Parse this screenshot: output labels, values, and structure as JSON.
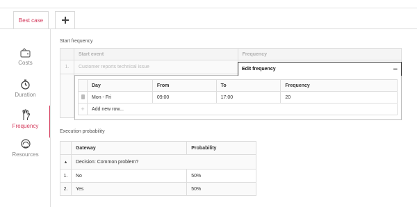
{
  "tabs": {
    "active_label": "Best case",
    "add_symbol": "+"
  },
  "sidebar": {
    "items": [
      {
        "label": "Costs",
        "icon": "wallet-icon"
      },
      {
        "label": "Duration",
        "icon": "stopwatch-icon"
      },
      {
        "label": "Frequency",
        "icon": "hand-icon"
      },
      {
        "label": "Resources",
        "icon": "head-icon"
      }
    ],
    "active_index": 2
  },
  "start_frequency": {
    "label": "Start frequency",
    "headers": [
      "Start event",
      "Frequency"
    ],
    "row": {
      "num": "1.",
      "event": "Customer reports technical issue"
    }
  },
  "edit_frequency": {
    "title": "Edit frequency",
    "collapse_symbol": "−",
    "headers": [
      "Day",
      "From",
      "To",
      "Frequency"
    ],
    "rows": [
      {
        "day": "Mon - Fri",
        "from": "09:00",
        "to": "17:00",
        "frequency": "20"
      }
    ],
    "add_row_symbol": "+",
    "add_row_placeholder": "Add new row..."
  },
  "execution_probability": {
    "label": "Execution probability",
    "headers": [
      "Gateway",
      "Probability"
    ],
    "decision": {
      "toggle": "▴",
      "label": "Decision: Common problem?"
    },
    "rows": [
      {
        "num": "1.",
        "label": "No",
        "probability": "50%"
      },
      {
        "num": "2.",
        "label": "Yes",
        "probability": "50%"
      }
    ]
  },
  "colors": {
    "accent": "#d4395b",
    "border": "#dddddd",
    "muted_text": "#b8b8b8"
  }
}
